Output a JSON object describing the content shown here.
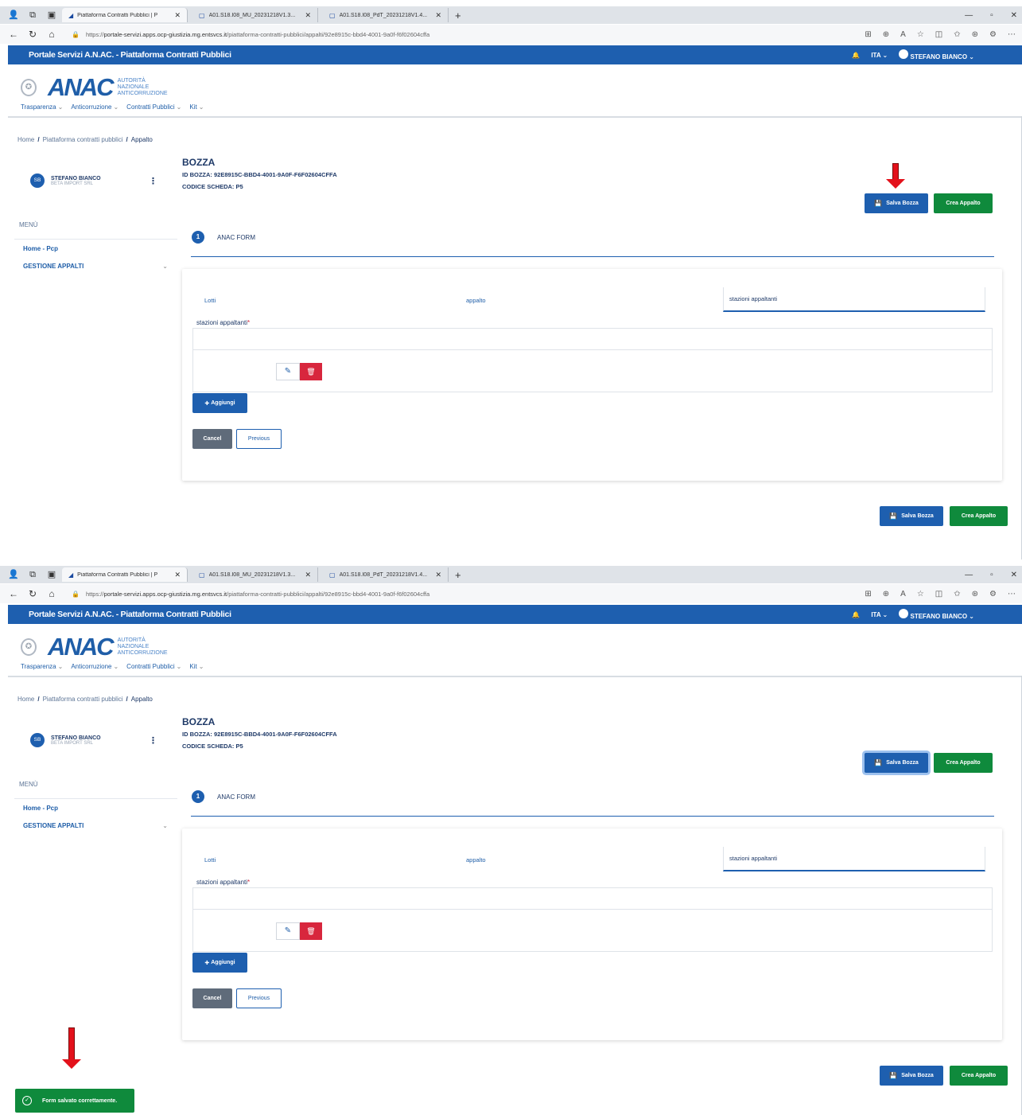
{
  "browser": {
    "tabs": [
      {
        "title": "Piattaforma Contratti Pubblici | P",
        "active": true
      },
      {
        "title": "A01.S18.I08_MU_20231218V1.3...",
        "active": false
      },
      {
        "title": "A01.S18.I08_PdT_20231218V1.4...",
        "active": false
      }
    ],
    "url_prefix": "https://",
    "url_host": "portale-servizi.apps.ocp-giustizia.mg.entsvcs.it",
    "url_path": "/piattaforma-contratti-pubblici/appalti/92e8915c-bbd4-4001-9a0f-f6f02604cffa"
  },
  "portal": {
    "title": "Portale Servizi A.N.AC. - Piattaforma Contratti Pubblici",
    "lang": "ITA",
    "user": "STEFANO BIANCO"
  },
  "logo": {
    "text": "ANAC",
    "line1": "Autorità",
    "line2": "Nazionale",
    "line3": "Anticorruzione"
  },
  "main_menu": [
    "Trasparenza",
    "Anticorruzione",
    "Contratti Pubblici",
    "Kit"
  ],
  "breadcrumb": [
    "Home",
    "Piattaforma contratti pubblici",
    "Appalto"
  ],
  "sidebar": {
    "initials": "SB",
    "name": "STEFANO BIANCO",
    "company": "BETA IMPORT SRL",
    "menu_label": "MENÙ",
    "items": [
      "Home - Pcp",
      "GESTIONE APPALTI"
    ]
  },
  "draft": {
    "title": "BOZZA",
    "id_line": "ID BOZZA: 92E8915C-BBD4-4001-9A0F-F6F02604CFFA",
    "code_line": "CODICE SCHEDA: P5"
  },
  "actions": {
    "save": "Salva Bozza",
    "create": "Crea Appalto"
  },
  "stepper": {
    "number": "1",
    "label": "ANAC FORM"
  },
  "form": {
    "tabs": [
      "Lotti",
      "appalto",
      "stazioni appaltanti"
    ],
    "active_tab": "stazioni appaltanti",
    "field_label": "stazioni appaltanti",
    "required_mark": "*",
    "add": "Aggiungi",
    "cancel": "Cancel",
    "previous": "Previous"
  },
  "toast": {
    "message": "Form salvato correttamente."
  },
  "colors": {
    "primary": "#1e5faf",
    "success": "#0f8a3c",
    "danger": "#d8263d",
    "annotation_arrow": "#e3111b"
  }
}
